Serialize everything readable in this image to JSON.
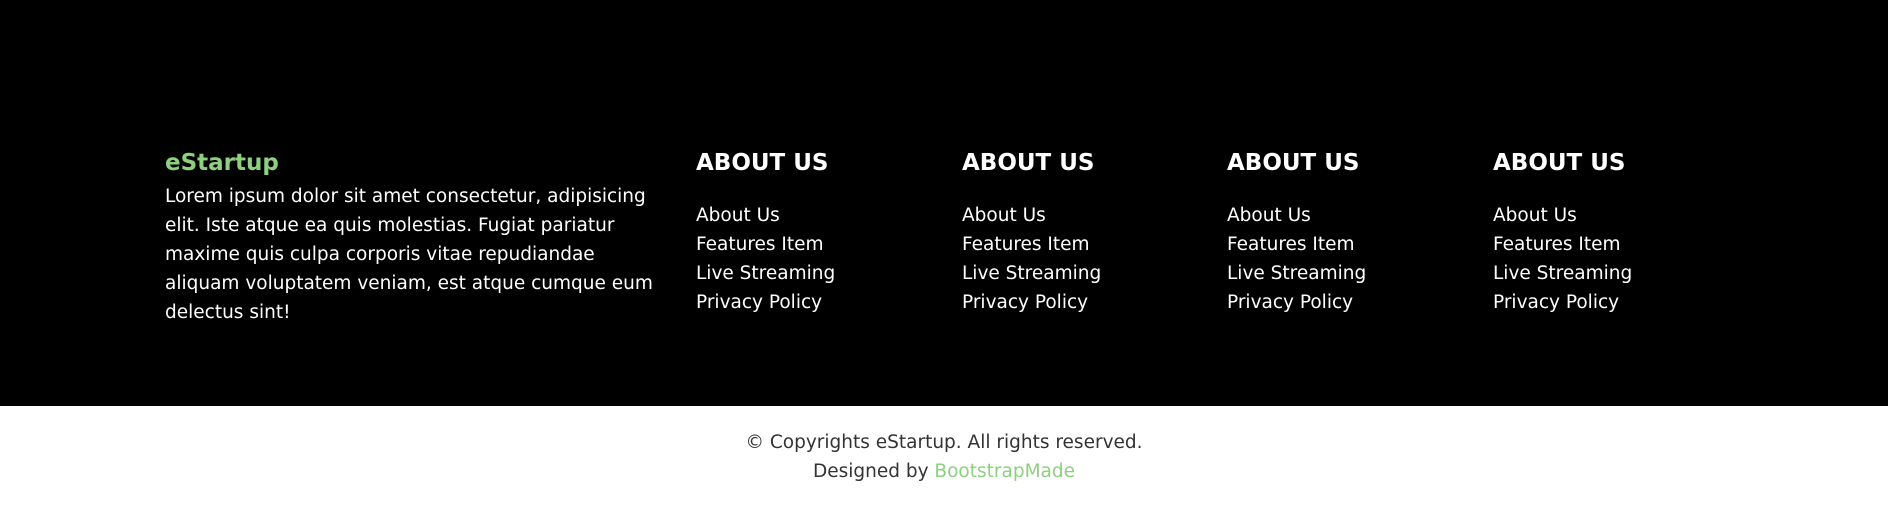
{
  "brand": {
    "name": "eStartup",
    "description": "Lorem ipsum dolor sit amet consectetur, adipisicing elit. Iste atque ea quis molestias. Fugiat pariatur maxime quis culpa corporis vitae repudiandae aliquam voluptatem veniam, est atque cumque eum delectus sint!"
  },
  "columns": [
    {
      "heading": "ABOUT US",
      "links": [
        "About Us",
        "Features Item",
        "Live Streaming",
        "Privacy Policy"
      ]
    },
    {
      "heading": "ABOUT US",
      "links": [
        "About Us",
        "Features Item",
        "Live Streaming",
        "Privacy Policy"
      ]
    },
    {
      "heading": "ABOUT US",
      "links": [
        "About Us",
        "Features Item",
        "Live Streaming",
        "Privacy Policy"
      ]
    },
    {
      "heading": "ABOUT US",
      "links": [
        "About Us",
        "Features Item",
        "Live Streaming",
        "Privacy Policy"
      ]
    }
  ],
  "bottom": {
    "copyright": "© Copyrights eStartup. All rights reserved.",
    "designed_by_prefix": "Designed by ",
    "designer_link": "BootstrapMade"
  },
  "colors": {
    "accent": "#8dd07f",
    "footer_bg": "#000000",
    "bottom_bg": "#ffffff"
  }
}
